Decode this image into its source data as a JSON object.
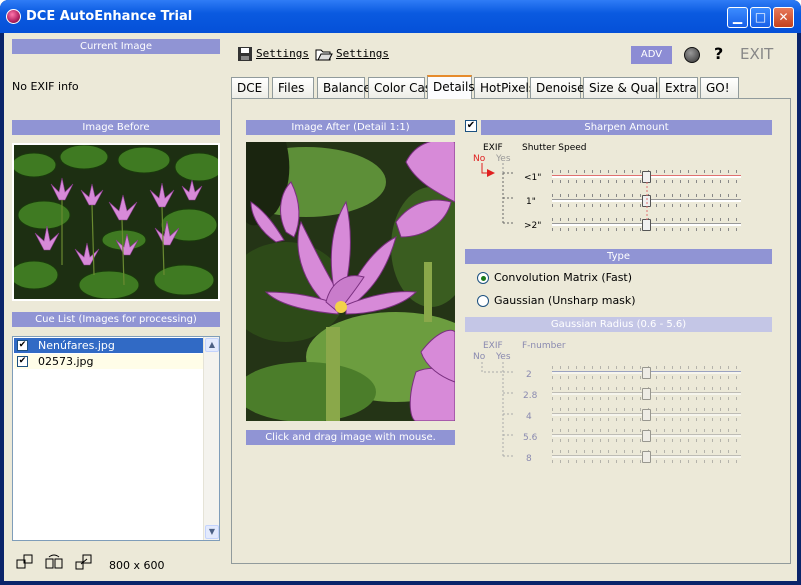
{
  "window": {
    "title": "DCE AutoEnhance Trial"
  },
  "left": {
    "current_image_header": "Current Image",
    "exif_info": "No EXIF info",
    "image_before_header": "Image Before",
    "cue_list_header": "Cue List (Images for processing)",
    "cue_items": [
      {
        "name": "Nenúfares.jpg",
        "checked": true,
        "selected": true
      },
      {
        "name": "02573.jpg",
        "checked": true,
        "selected": false
      }
    ],
    "image_size": "800 x 600"
  },
  "toolbar": {
    "settings_save_label": "Settings",
    "settings_open_label": "Settings",
    "adv_label": "ADV",
    "exit_label": "EXIT",
    "help_label": "?"
  },
  "tabs": [
    "DCE",
    "Files",
    "Balance",
    "Color Cast",
    "Details",
    "HotPixels",
    "Denoiser",
    "Size & Quality",
    "Extra",
    "GO!"
  ],
  "active_tab": "Details",
  "details": {
    "image_after_header": "Image After (Detail 1:1)",
    "drag_hint": "Click and drag image with mouse.",
    "sharpen": {
      "header": "Sharpen Amount",
      "checked": true,
      "exif_label": "EXIF",
      "no_label": "No",
      "yes_label": "Yes",
      "param_label": "Shutter Speed",
      "rows": [
        {
          "label": "<1\"",
          "value": 0.62
        },
        {
          "label": "1\"",
          "value": 0.62
        },
        {
          "label": ">2\"",
          "value": 0.62
        }
      ]
    },
    "type": {
      "header": "Type",
      "options": [
        {
          "label": "Convolution Matrix (Fast)",
          "selected": true
        },
        {
          "label": "Gaussian (Unsharp mask)",
          "selected": false
        }
      ]
    },
    "gaussian": {
      "header": "Gaussian Radius (0.6 - 5.6)",
      "exif_label": "EXIF",
      "no_label": "No",
      "yes_label": "Yes",
      "param_label": "F-number",
      "rows": [
        {
          "label": "2",
          "value": 0.5
        },
        {
          "label": "2.8",
          "value": 0.5
        },
        {
          "label": "4",
          "value": 0.5
        },
        {
          "label": "5.6",
          "value": 0.5
        },
        {
          "label": "8",
          "value": 0.5
        }
      ]
    }
  },
  "colors": {
    "accent_header": "#9094d4",
    "title_bar": "#0a5ae0",
    "red_marker": "#e02020"
  }
}
